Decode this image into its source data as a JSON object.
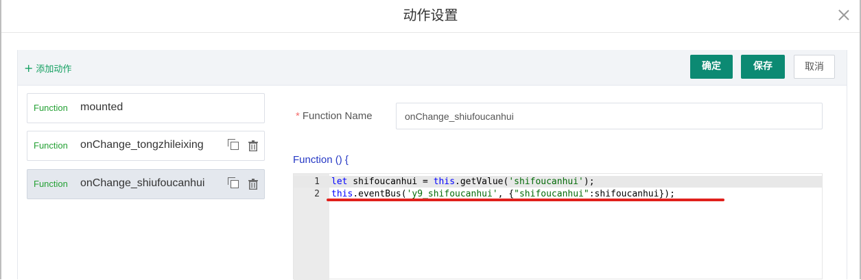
{
  "dialog": {
    "title": "动作设置"
  },
  "left": {
    "add_action_label": "添加动作",
    "functions": [
      {
        "keyword": "Function",
        "name": "mounted"
      },
      {
        "keyword": "Function",
        "name": "onChange_tongzhileixing"
      },
      {
        "keyword": "Function",
        "name": "onChange_shiufoucanhui"
      }
    ]
  },
  "toolbar": {
    "confirm_label": "确定",
    "save_label": "保存",
    "cancel_label": "取消"
  },
  "form": {
    "function_name_label": "Function Name",
    "required_mark": "*",
    "function_name_value": "onChange_shiufoucanhui",
    "function_open": "Function () {"
  },
  "editor": {
    "lines": [
      {
        "num": "1",
        "kw": "let",
        "rest_a": " shifoucanhui = ",
        "kw2": "this",
        "rest_b": ".getValue(",
        "str": "'shifoucanhui'",
        "rest_c": ");"
      },
      {
        "num": "2",
        "kw": "this",
        "rest_a": ".eventBus(",
        "str": "'y9_shifoucanhui'",
        "rest_b": ", {",
        "str2": "\"shifoucanhui\"",
        "rest_c": ":shifoucanhui});"
      }
    ]
  },
  "colors": {
    "primary": "#0c8a73",
    "keyword_green": "#23a033",
    "annotation_red": "#e0201c"
  }
}
